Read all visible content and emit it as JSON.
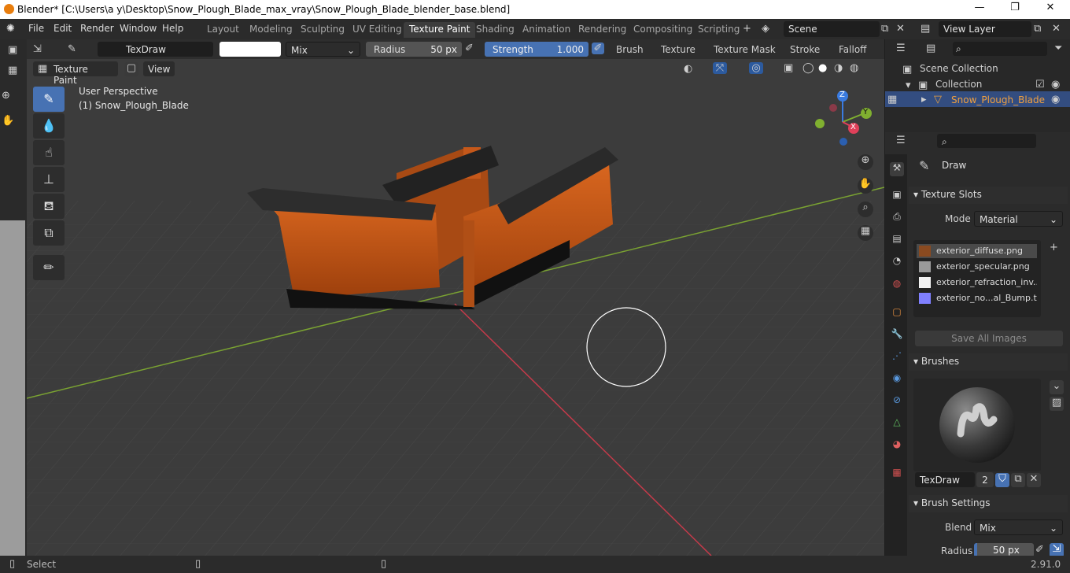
{
  "window": {
    "title": "Blender* [C:\\Users\\a y\\Desktop\\Snow_Plough_Blade_max_vray\\Snow_Plough_Blade_blender_base.blend]",
    "min": "—",
    "max": "❐",
    "close": "✕"
  },
  "menu": [
    "File",
    "Edit",
    "Render",
    "Window",
    "Help"
  ],
  "workspaces": [
    "Layout",
    "Modeling",
    "Sculpting",
    "UV Editing",
    "Texture Paint",
    "Shading",
    "Animation",
    "Rendering",
    "Compositing",
    "Scripting"
  ],
  "scene": "Scene",
  "view_layer": "View Layer",
  "tool_header": {
    "brush_name": "TexDraw",
    "blend": "Mix",
    "radius_label": "Radius",
    "radius_value": "50 px",
    "strength_label": "Strength",
    "strength_value": "1.000",
    "strength_fraction": 1.0,
    "dropdowns": [
      "Brush",
      "Texture",
      "Texture Mask",
      "Stroke",
      "Falloff"
    ]
  },
  "viewport_header": {
    "mode": "Texture Paint",
    "view": "View"
  },
  "viewport": {
    "perspective": "User Perspective",
    "object": "(1) Snow_Plough_Blade",
    "gizmo": {
      "z": "Z",
      "y": "Y",
      "x": "X"
    }
  },
  "outliner": {
    "scene_collection": "Scene Collection",
    "collection": "Collection",
    "object": "Snow_Plough_Blade"
  },
  "properties": {
    "tool_name": "Draw",
    "texture_slots": {
      "header": "Texture Slots",
      "mode_label": "Mode",
      "mode_value": "Material",
      "slots": [
        {
          "name": "exterior_diffuse.png",
          "swatch": "#8a4a20"
        },
        {
          "name": "exterior_specular.png",
          "swatch": "#9a9a9a"
        },
        {
          "name": "exterior_refraction_inv...",
          "swatch": "#f2f2f2"
        },
        {
          "name": "exterior_no...al_Bump.tga",
          "swatch": "#8080ff"
        }
      ],
      "save_all": "Save All Images"
    },
    "brushes": {
      "header": "Brushes",
      "name": "TexDraw",
      "users": "2"
    },
    "brush_settings": {
      "header": "Brush Settings",
      "blend_label": "Blend",
      "blend_value": "Mix",
      "radius_label": "Radius",
      "radius_value": "50 px"
    }
  },
  "status": {
    "select": "Select",
    "version": "2.91.0"
  },
  "colors": {
    "accent": "#4772b3",
    "selected_text": "#f0a040",
    "axis_x": "#e0405a",
    "axis_y": "#80b030",
    "axis_z": "#3a7be0"
  }
}
